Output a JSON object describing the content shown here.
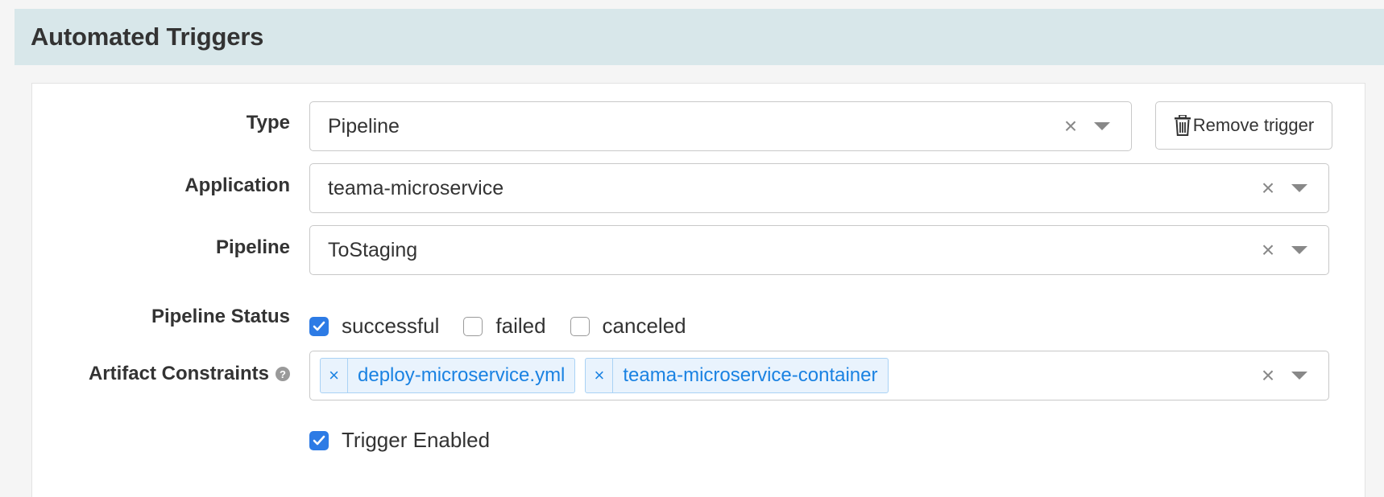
{
  "header": {
    "title": "Automated Triggers"
  },
  "form": {
    "type": {
      "label": "Type",
      "value": "Pipeline"
    },
    "remove_button": {
      "label": "Remove trigger",
      "icon": "trash-icon"
    },
    "application": {
      "label": "Application",
      "value": "teama-microservice"
    },
    "pipeline": {
      "label": "Pipeline",
      "value": "ToStaging"
    },
    "pipeline_status": {
      "label": "Pipeline Status",
      "options": [
        {
          "label": "successful",
          "checked": true
        },
        {
          "label": "failed",
          "checked": false
        },
        {
          "label": "canceled",
          "checked": false
        }
      ]
    },
    "artifact_constraints": {
      "label": "Artifact Constraints",
      "help_icon": "question-circle-icon",
      "tags": [
        {
          "remove": "×",
          "label": "deploy-microservice.yml"
        },
        {
          "remove": "×",
          "label": "teama-microservice-container"
        }
      ]
    },
    "trigger_enabled": {
      "label": "Trigger Enabled",
      "checked": true
    },
    "clear_glyph": "×"
  },
  "colors": {
    "header_bg": "#d8e7ea",
    "accent": "#2d7be5",
    "tag_text": "#1a82e2",
    "tag_bg": "#e9f3fd"
  }
}
